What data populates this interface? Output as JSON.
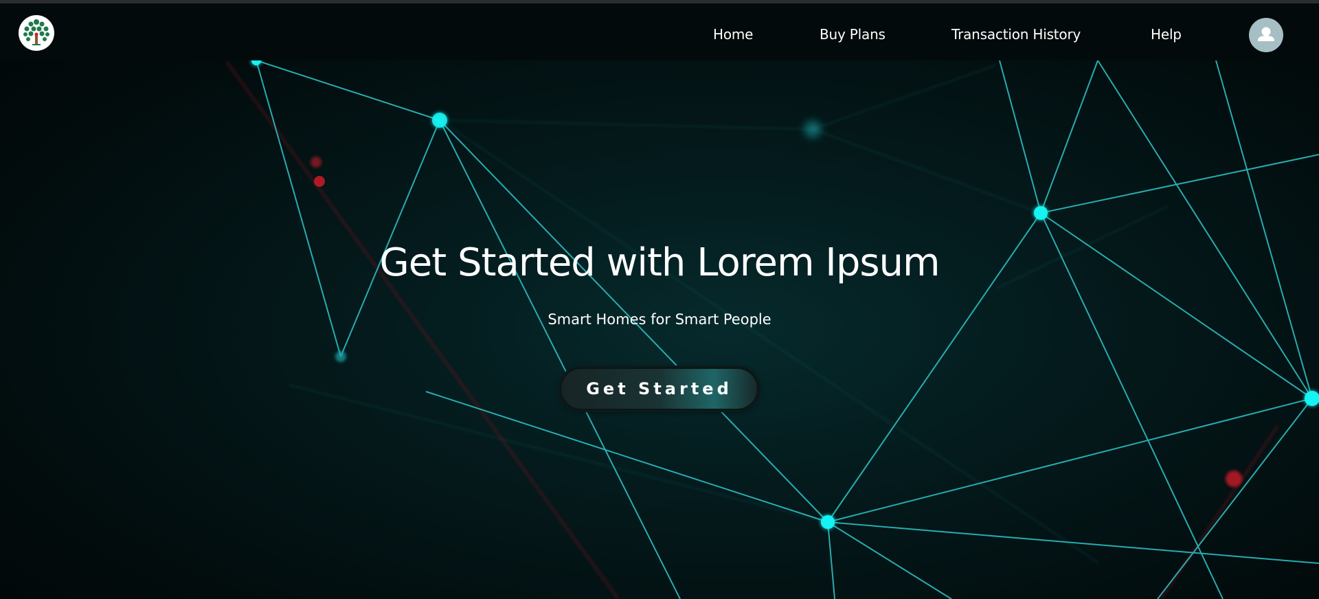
{
  "nav": {
    "links": [
      {
        "label": "Home"
      },
      {
        "label": "Buy Plans"
      },
      {
        "label": "Transaction History"
      },
      {
        "label": "Help"
      }
    ],
    "logo_icon": "tree-logo-icon",
    "avatar_icon": "user-avatar-icon"
  },
  "hero": {
    "title": "Get Started with Lorem Ipsum",
    "subtitle": "Smart Homes for Smart People",
    "cta_label": "Get Started"
  },
  "colors": {
    "background": "#020c0d",
    "navbar": "#030a0b",
    "network_line": "#2fd3d6",
    "network_node": "#19f3f3",
    "accent_red": "#d81b2a",
    "avatar_bg": "#a6bfc4",
    "logo_green": "#1e7a4a"
  }
}
